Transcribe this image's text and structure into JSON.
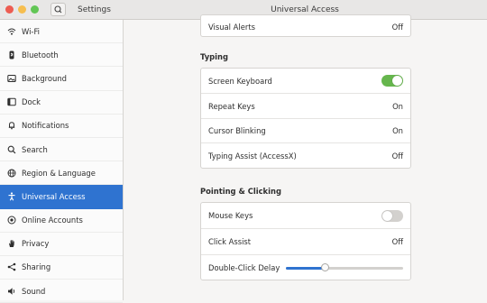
{
  "header": {
    "app_title": "Settings",
    "window_title": "Universal Access"
  },
  "sidebar": {
    "items": [
      {
        "label": "Wi-Fi",
        "icon": "wifi-icon"
      },
      {
        "label": "Bluetooth",
        "icon": "bluetooth-icon"
      },
      {
        "label": "Background",
        "icon": "background-icon"
      },
      {
        "label": "Dock",
        "icon": "dock-icon"
      },
      {
        "label": "Notifications",
        "icon": "bell-icon"
      },
      {
        "label": "Search",
        "icon": "search-icon"
      },
      {
        "label": "Region & Language",
        "icon": "globe-icon"
      },
      {
        "label": "Universal Access",
        "icon": "accessibility-icon",
        "active": true
      },
      {
        "label": "Online Accounts",
        "icon": "online-accounts-icon"
      },
      {
        "label": "Privacy",
        "icon": "hand-icon"
      },
      {
        "label": "Sharing",
        "icon": "share-icon"
      },
      {
        "label": "Sound",
        "icon": "speaker-icon"
      }
    ]
  },
  "seeing": {
    "visual_alerts": {
      "label": "Visual Alerts",
      "value": "Off"
    }
  },
  "typing": {
    "title": "Typing",
    "screen_keyboard": {
      "label": "Screen Keyboard",
      "on": true
    },
    "repeat_keys": {
      "label": "Repeat Keys",
      "value": "On"
    },
    "cursor_blinking": {
      "label": "Cursor Blinking",
      "value": "On"
    },
    "typing_assist": {
      "label": "Typing Assist (AccessX)",
      "value": "Off"
    }
  },
  "pointing": {
    "title": "Pointing & Clicking",
    "mouse_keys": {
      "label": "Mouse Keys",
      "on": false
    },
    "click_assist": {
      "label": "Click Assist",
      "value": "Off"
    },
    "double_click_delay": {
      "label": "Double-Click Delay",
      "level": 0.33
    }
  },
  "colors": {
    "accent": "#2f73d0",
    "toggle_on": "#66b64d"
  }
}
